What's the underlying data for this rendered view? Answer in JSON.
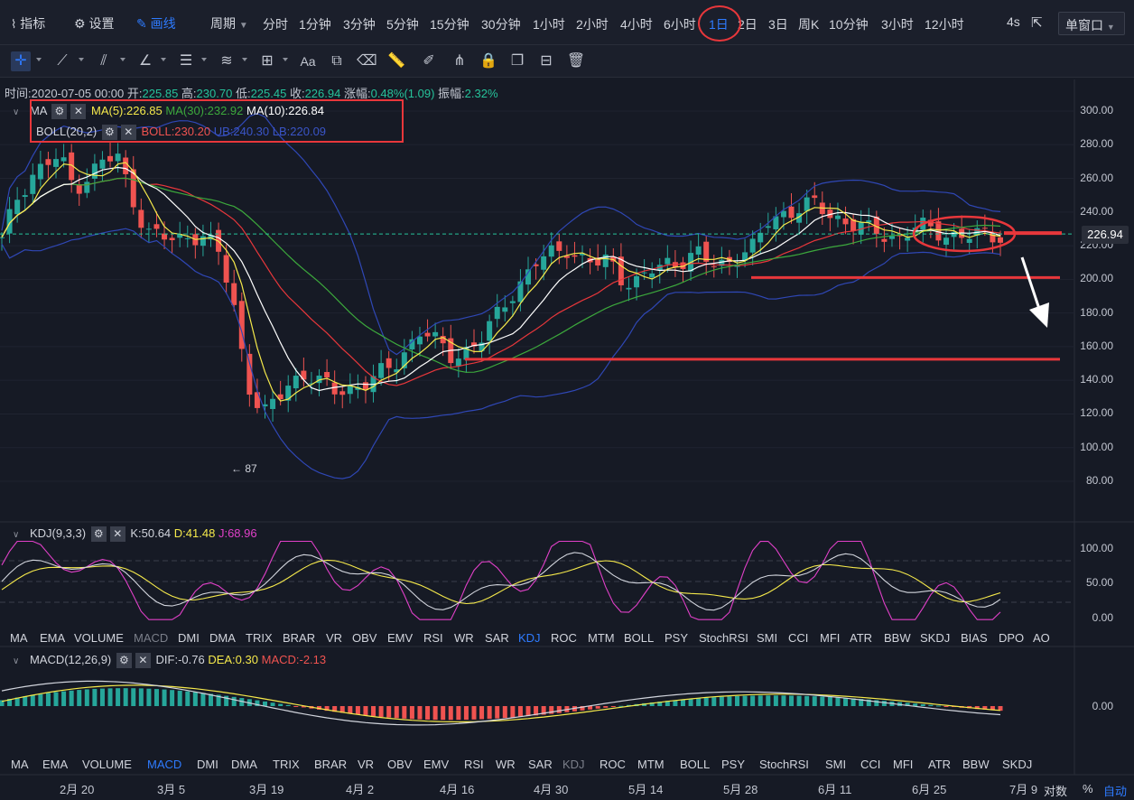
{
  "toolbar": {
    "indicators_label": "指标",
    "settings_label": "设置",
    "draw_label": "画线",
    "period_label": "周期",
    "periods": [
      "分时",
      "1分钟",
      "3分钟",
      "5分钟",
      "15分钟",
      "30分钟",
      "1小时",
      "2小时",
      "4小时",
      "6小时",
      "1日",
      "2日",
      "3日",
      "周K",
      "10分钟",
      "3小时",
      "12小时"
    ],
    "active_period": "1日",
    "refresh": "4s",
    "window_label": "单窗口"
  },
  "ohlc": {
    "time_label": "时间:",
    "time": "2020-07-05 00:00",
    "open_label": "开:",
    "open": "225.85",
    "high_label": "高:",
    "high": "230.70",
    "low_label": "低:",
    "low": "225.45",
    "close_label": "收:",
    "close": "226.94",
    "change_label": "涨幅:",
    "change": "0.48%(1.09)",
    "amp_label": "振幅:",
    "amp": "2.32%"
  },
  "legend": {
    "ma_name": "MA",
    "ma5": "MA(5):226.85",
    "ma30": "MA(30):232.92",
    "ma10": "MA(10):226.84",
    "boll_name": "BOLL(20,2)",
    "boll": "BOLL:230.20",
    "ub": "UB:240.30",
    "lb": "LB:220.09",
    "kdj_name": "KDJ(9,3,3)",
    "k": "K:50.64",
    "d": "D:41.48",
    "j": "J:68.96",
    "macd_name": "MACD(12,26,9)",
    "dif": "DIF:-0.76",
    "dea": "DEA:0.30",
    "macd": "MACD:-2.13"
  },
  "colors": {
    "up": "#26a69a",
    "down": "#ef5350",
    "ma5": "#f5e94b",
    "ma10": "#ffffff",
    "ma30": "#3ca83c",
    "boll_mid": "#e8373b",
    "boll_band": "#2f47b5",
    "annot": "#e8373b",
    "active": "#2e7bff"
  },
  "price_axis": [
    "300.00",
    "280.00",
    "260.00",
    "240.00",
    "220.00",
    "200.00",
    "180.00",
    "160.00",
    "140.00",
    "120.00",
    "100.00",
    "80.00"
  ],
  "current_price": "226.94",
  "low_marker": "← 87",
  "kdj_axis": [
    "100.00",
    "50.00",
    "0.00"
  ],
  "macd_axis": [
    "0.00"
  ],
  "indicator_tabs_1": [
    "MA",
    "EMA",
    "VOLUME",
    "MACD",
    "DMI",
    "DMA",
    "TRIX",
    "BRAR",
    "VR",
    "OBV",
    "EMV",
    "RSI",
    "WR",
    "SAR",
    "KDJ",
    "ROC",
    "MTM",
    "BOLL",
    "PSY",
    "StochRSI",
    "SMI",
    "CCI",
    "MFI",
    "ATR",
    "BBW",
    "SKDJ",
    "BIAS",
    "DPO",
    "AO"
  ],
  "indicator_tabs_2": [
    "MA",
    "EMA",
    "VOLUME",
    "MACD",
    "DMI",
    "DMA",
    "TRIX",
    "BRAR",
    "VR",
    "OBV",
    "EMV",
    "RSI",
    "WR",
    "SAR",
    "KDJ",
    "ROC",
    "MTM",
    "BOLL",
    "PSY",
    "StochRSI",
    "SMI",
    "CCI",
    "MFI",
    "ATR",
    "BBW",
    "SKDJ"
  ],
  "footer": {
    "log_label": "对数",
    "pct_label": "%",
    "auto_label": "自动"
  },
  "chart_data": {
    "type": "candlestick",
    "x_ticks": [
      "2月 20",
      "3月 5",
      "3月 19",
      "4月 2",
      "4月 16",
      "4月 30",
      "5月 14",
      "5月 28",
      "6月 11",
      "6月 25",
      "7月 9"
    ],
    "ylim": [
      65,
      310
    ],
    "close_path": [
      222,
      248,
      262,
      268,
      272,
      255,
      262,
      270,
      272,
      250,
      228,
      225,
      222,
      228,
      225,
      215,
      185,
      140,
      118,
      128,
      140,
      145,
      138,
      133,
      136,
      138,
      142,
      148,
      160,
      170,
      162,
      155,
      158,
      162,
      175,
      190,
      200,
      210,
      215,
      220,
      212,
      208,
      212,
      200,
      198,
      205,
      210,
      212,
      215,
      208,
      210,
      216,
      218,
      235,
      240,
      242,
      244,
      240,
      236,
      232,
      228,
      227,
      225,
      230,
      230,
      228,
      226,
      225,
      226,
      227
    ],
    "support_lines": [
      228,
      200,
      152
    ],
    "kdj_range": [
      -10,
      110
    ],
    "macd_zero": 0
  }
}
